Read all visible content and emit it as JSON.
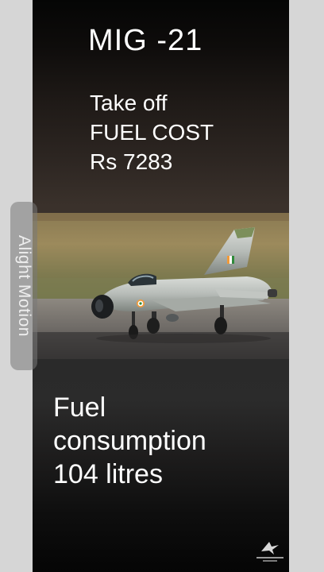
{
  "video": {
    "title": "MIG -21",
    "cost_lines": [
      "Take off",
      "FUEL COST",
      "Rs 7283"
    ],
    "fuel_lines": [
      "Fuel",
      "consumption",
      "104 litres"
    ]
  },
  "watermark": {
    "label": "Alight Motion"
  },
  "colors": {
    "text": "#ffffff",
    "background_side": "#d6d6d6",
    "watermark_bg": "#8a8a8a"
  },
  "icons": {
    "corner_logo": "aviation-logo-icon"
  }
}
